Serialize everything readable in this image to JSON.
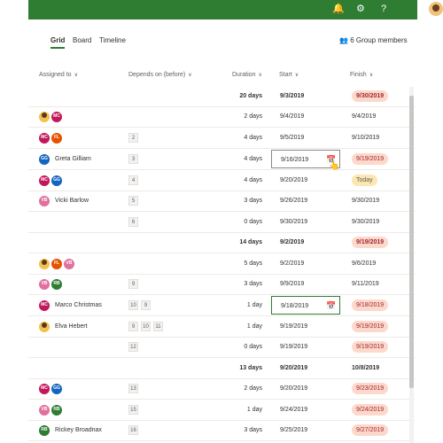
{
  "tabs": [
    {
      "label": "Grid"
    },
    {
      "label": "Board"
    },
    {
      "label": "Timeline"
    }
  ],
  "members_label": "6 Group members",
  "columns": {
    "assigned": "Assigned to",
    "depends": "Depends on (before)",
    "duration": "Duration",
    "start": "Start",
    "finish": "Finish"
  },
  "colors": {
    "brand": "#2e7d32",
    "late_pill": "#fcd9cc",
    "today_pill": "#fde7b0"
  },
  "rows": [
    {
      "duration": "20 days",
      "start": "9/3/2019",
      "finish": "9/30/2019"
    },
    {
      "duration": "2 days",
      "start": "9/4/2019",
      "finish": "9/4/2019"
    },
    {
      "duration": "4 days",
      "start": "9/5/2019",
      "finish": "9/10/2019",
      "dep": [
        "2"
      ]
    },
    {
      "name": "Greta Gilliam",
      "duration": "4 days",
      "start": "9/16/2019",
      "finish": "9/19/2019",
      "dep": [
        "3"
      ]
    },
    {
      "duration": "4 days",
      "start": "9/20/2019",
      "finish": "Today",
      "dep": [
        "4"
      ]
    },
    {
      "name": "Vicki Barlow",
      "duration": "3 days",
      "start": "9/26/2019",
      "finish": "9/30/2019",
      "dep": [
        "5"
      ]
    },
    {
      "duration": "0 days",
      "start": "9/30/2019",
      "finish": "9/30/2019",
      "dep": [
        "6"
      ]
    },
    {
      "duration": "14 days",
      "start": "9/2/2019",
      "finish": "9/19/2019"
    },
    {
      "duration": "5 days",
      "start": "9/2/2019",
      "finish": "9/6/2019"
    },
    {
      "duration": "3 days",
      "start": "9/9/2019",
      "finish": "9/11/2019",
      "dep": [
        "9"
      ]
    },
    {
      "name": "Marco Christmas",
      "duration": "1 day",
      "start": "9/18/2019",
      "finish": "9/18/2019",
      "dep": [
        "10",
        "9"
      ]
    },
    {
      "name": "Elva Hebert",
      "duration": "1 day",
      "start": "9/19/2019",
      "finish": "9/19/2019",
      "dep": [
        "9",
        "10",
        "11"
      ]
    },
    {
      "duration": "0 days",
      "start": "9/19/2019",
      "finish": "9/19/2019",
      "dep": [
        "12"
      ]
    },
    {
      "duration": "13 days",
      "start": "9/20/2019",
      "finish": "10/8/2019"
    },
    {
      "duration": "2 days",
      "start": "9/20/2019",
      "finish": "9/23/2019",
      "dep": [
        "13"
      ]
    },
    {
      "duration": "1 day",
      "start": "9/24/2019",
      "finish": "9/24/2019",
      "dep": [
        "15"
      ]
    },
    {
      "name": "Rickey Broadnax",
      "duration": "3 days",
      "start": "9/25/2019",
      "finish": "9/27/2019",
      "dep": [
        "16"
      ]
    }
  ],
  "avatars": [
    [],
    [
      "MC"
    ],
    [
      "MC",
      "FL"
    ],
    [
      "GG"
    ],
    [
      "MC",
      "GG"
    ],
    [
      "VB"
    ],
    [],
    [],
    [
      "FL",
      "VB"
    ],
    [
      "VB",
      "RB"
    ],
    [
      "MC"
    ],
    [],
    [],
    [],
    [
      "MC",
      "GG"
    ],
    [
      "VB",
      "RB"
    ],
    [
      "RB"
    ]
  ]
}
